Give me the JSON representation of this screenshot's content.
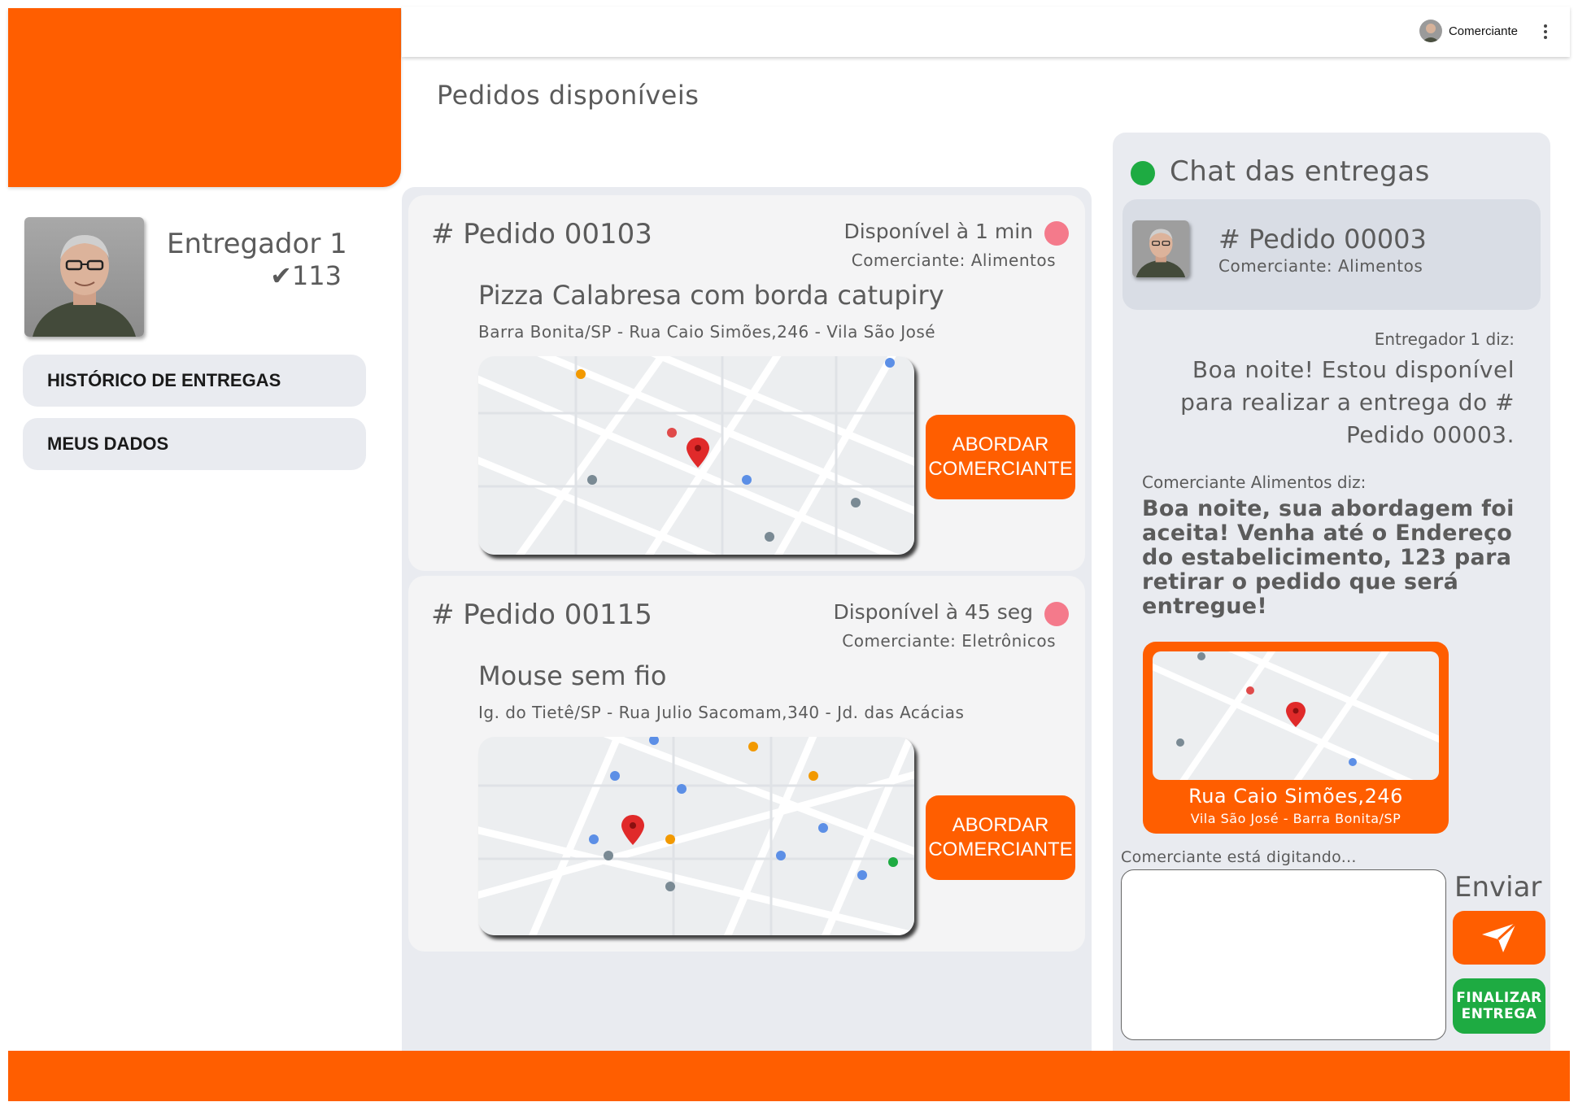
{
  "topbar": {
    "user_name": "Comerciante",
    "menu_icon": "kebab-menu-icon"
  },
  "page": {
    "title": "Pedidos disponíveis"
  },
  "profile": {
    "name": "Entregador 1",
    "deliveries": "✔113"
  },
  "sidebar": {
    "items": [
      {
        "label": "HISTÓRICO DE ENTREGAS"
      },
      {
        "label": "MEUS DADOS"
      }
    ]
  },
  "orders": [
    {
      "id": "# Pedido 00103",
      "availability": "Disponível à 1 min",
      "merchant": "Comerciante: Alimentos",
      "product": "Pizza Calabresa com borda catupiry",
      "address": "Barra Bonita/SP - Rua Caio Simões,246 - Vila São José",
      "action_label": "ABORDAR COMERCIANTE"
    },
    {
      "id": "# Pedido 00115",
      "availability": "Disponível à  45 seg",
      "merchant": "Comerciante: Eletrônicos",
      "product": "Mouse sem fio",
      "address": "Ig. do Tietê/SP - Rua Julio Sacomam,340 - Jd. das Acácias",
      "action_label": "ABORDAR COMERCIANTE"
    }
  ],
  "colors": {
    "brand": "#ff5e00",
    "panel": "#e9ebf0",
    "online": "#1eab42",
    "status_dot": "#f47a8b"
  },
  "chat": {
    "title": "Chat das entregas",
    "order": "# Pedido 00003",
    "merchant": "Comerciante: Alimentos",
    "messages": [
      {
        "author": "Entregador 1 diz:",
        "text": "Boa noite! Estou disponível para realizar a entrega do # Pedido 00003."
      },
      {
        "author": "Comerciante Alimentos diz:",
        "text": "Boa noite, sua abordagem foi aceita! Venha até o Endereço do estabelicimento, 123 para retirar  o pedido que será entregue!"
      }
    ],
    "location": {
      "street": "Rua Caio Simões,246",
      "city": "Vila São José - Barra Bonita/SP"
    },
    "typing": "Comerciante está digitando...",
    "input_value": "",
    "send_label": "Enviar",
    "finish_label": "FINALIZAR ENTREGA"
  }
}
